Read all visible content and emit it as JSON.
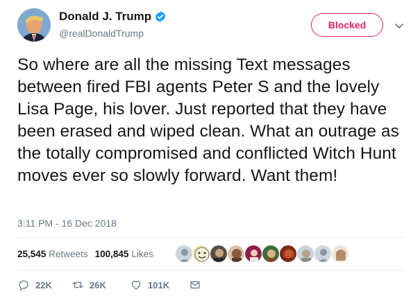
{
  "author": {
    "display_name": "Donald J. Trump",
    "handle": "@realDonaldTrump",
    "verified": true,
    "verified_color": "#1da1f2"
  },
  "header": {
    "blocked_label": "Blocked",
    "blocked_color": "#e0245e"
  },
  "tweet": {
    "text": "So where are all the missing Text messages between fired FBI agents Peter S and the lovely Lisa Page, his lover. Just reported that they have been erased and wiped clean. What an outrage as the totally compromised and conflicted Witch Hunt moves ever so slowly forward. Want them!",
    "timestamp": "3:11 PM - 16 Dec 2018"
  },
  "stats": {
    "retweets_count": "25,545",
    "retweets_label": "Retweets",
    "likes_count": "100,845",
    "likes_label": "Likes"
  },
  "liker_avatars": [
    "default-avatar",
    "meme-face-avatar",
    "photo-avatar",
    "cartoon-avatar",
    "photo-avatar",
    "photo-avatar",
    "photo-avatar",
    "photo-avatar",
    "default-avatar",
    "photo-avatar"
  ],
  "actions": {
    "reply_count": "22K",
    "retweet_count": "26K",
    "like_count": "101K"
  },
  "icons": [
    "verified-badge-icon",
    "chevron-down-icon",
    "reply-icon",
    "retweet-icon",
    "heart-icon",
    "envelope-icon"
  ]
}
